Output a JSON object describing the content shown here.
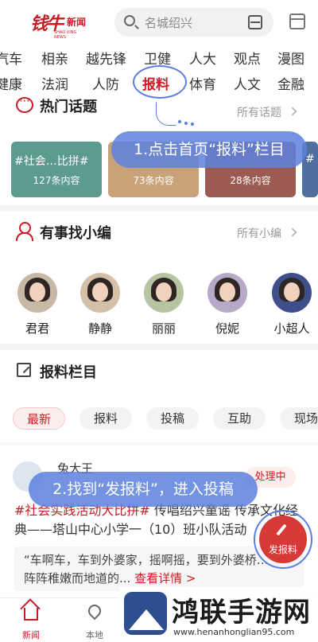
{
  "app": {
    "logo_text": "钱牛",
    "logo_word": "新闻",
    "logo_sub": "SHAO XING NEWS"
  },
  "search": {
    "placeholder": "名城绍兴"
  },
  "nav": {
    "row1": [
      "汽车",
      "相亲",
      "越先锋",
      "卫健",
      "人大",
      "观点",
      "漫图"
    ],
    "row2": [
      "健康",
      "法润",
      "人防",
      "报料",
      "体育",
      "人文",
      "金融"
    ],
    "active": "报料"
  },
  "hot_topics": {
    "title": "热门话题",
    "more": "所有话题",
    "cards": [
      {
        "title": "#社会…比拼#",
        "count": "127条内容"
      },
      {
        "title": "",
        "count": "73条内容"
      },
      {
        "title": "",
        "count": "28条内容"
      },
      {
        "title": "#",
        "count": ""
      }
    ]
  },
  "annotations": {
    "step1": "1.点击首页“报料”栏目",
    "step2": "2.找到“发报料”，进入投稿"
  },
  "editors": {
    "title": "有事找小编",
    "more": "所有小编",
    "people": [
      "君君",
      "静静",
      "丽丽",
      "倪妮",
      "小超人"
    ]
  },
  "report": {
    "title": "报料栏目",
    "chips": [
      "最新",
      "报料",
      "投稿",
      "互助",
      "现场"
    ],
    "active_chip": "最新"
  },
  "post": {
    "user": "兔大王",
    "status": "处理中",
    "tag": "#社会实践活动大比拼#",
    "title_rest": " 传唱绍兴童谣 传承文化经典——塔山中心小学一（10）班小队活动",
    "quote": "“车啊车，车到外婆家，摇啊摇，要到外婆桥…”一阵阵稚嫩而地道的...",
    "more": "查看详情 >"
  },
  "fab": {
    "label": "发报料"
  },
  "tabs": [
    {
      "label": "新闻",
      "icon": "home-icon"
    },
    {
      "label": "本地",
      "icon": "location-pin-icon"
    }
  ],
  "watermark": {
    "title": "鸿联手游网",
    "url": "www.henanhonglian95.com"
  },
  "colors": {
    "brand": "#c81d25",
    "annotation": "#5a7fe0"
  }
}
